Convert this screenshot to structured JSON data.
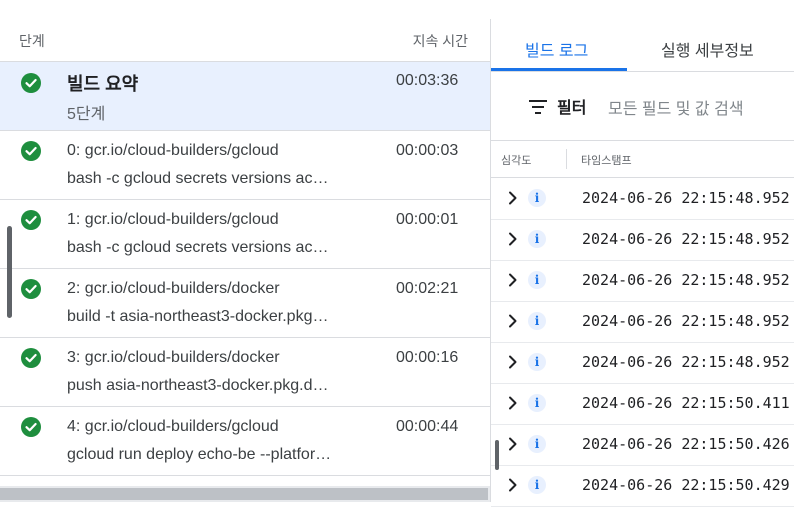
{
  "steps_table": {
    "col_step": "단계",
    "col_duration": "지속 시간",
    "summary": {
      "name": "빌드 요약",
      "sub": "5단계",
      "duration": "00:03:36",
      "status": "success"
    },
    "rows": [
      {
        "name": "0: gcr.io/cloud-builders/gcloud",
        "args": "bash -c gcloud secrets versions ac…",
        "duration": "00:00:03",
        "status": "success"
      },
      {
        "name": "1: gcr.io/cloud-builders/gcloud",
        "args": "bash -c gcloud secrets versions ac…",
        "duration": "00:00:01",
        "status": "success"
      },
      {
        "name": "2: gcr.io/cloud-builders/docker",
        "args": "build -t asia-northeast3-docker.pkg…",
        "duration": "00:02:21",
        "status": "success"
      },
      {
        "name": "3: gcr.io/cloud-builders/docker",
        "args": "push asia-northeast3-docker.pkg.d…",
        "duration": "00:00:16",
        "status": "success"
      },
      {
        "name": "4: gcr.io/cloud-builders/gcloud",
        "args": "gcloud run deploy echo-be --platfor…",
        "duration": "00:00:44",
        "status": "success"
      }
    ]
  },
  "tabs": [
    {
      "label": "빌드 로그",
      "active": true
    },
    {
      "label": "실행 세부정보",
      "active": false
    }
  ],
  "filter": {
    "label": "필터",
    "placeholder": "모든 필드 및 값 검색"
  },
  "log_table": {
    "col_severity": "심각도",
    "col_timestamp": "타임스탬프",
    "rows": [
      {
        "severity": "info",
        "timestamp": "2024-06-26 22:15:48.952"
      },
      {
        "severity": "info",
        "timestamp": "2024-06-26 22:15:48.952"
      },
      {
        "severity": "info",
        "timestamp": "2024-06-26 22:15:48.952"
      },
      {
        "severity": "info",
        "timestamp": "2024-06-26 22:15:48.952"
      },
      {
        "severity": "info",
        "timestamp": "2024-06-26 22:15:48.952"
      },
      {
        "severity": "info",
        "timestamp": "2024-06-26 22:15:50.411"
      },
      {
        "severity": "info",
        "timestamp": "2024-06-26 22:15:50.426"
      },
      {
        "severity": "info",
        "timestamp": "2024-06-26 22:15:50.429"
      }
    ]
  },
  "colors": {
    "accent": "#1a73e8",
    "success": "#1e8e3e",
    "selected_row": "#e8f0fe"
  }
}
